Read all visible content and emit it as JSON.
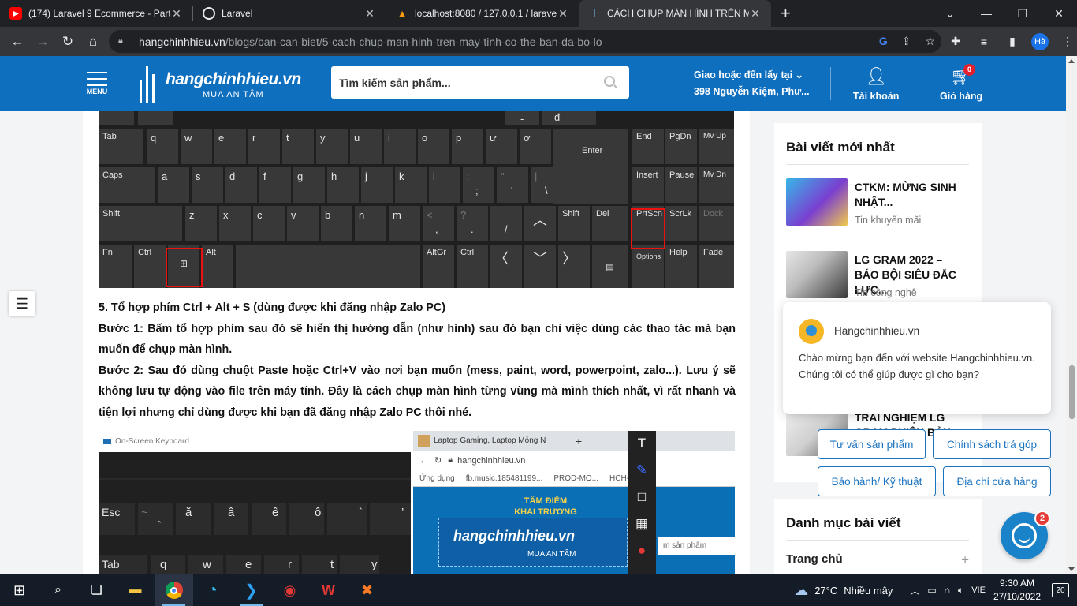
{
  "browser": {
    "tabs": [
      {
        "title": "(174) Laravel 9 Ecommerce - Part",
        "icon": "youtube-icon",
        "color": "#ff0000"
      },
      {
        "title": "Laravel",
        "icon": "globe-icon",
        "color": "#e8eaed"
      },
      {
        "title": "localhost:8080 / 127.0.0.1 / larave",
        "icon": "phpmyadmin-icon",
        "color": "#f89c0e"
      },
      {
        "title": "CÁCH CHỤP MÀN HÌNH TRÊN M",
        "icon": "hangchinhhieu-icon",
        "color": "#0f6fbf"
      }
    ],
    "new_tab": "+",
    "url_domain": "hangchinhhieu.vn",
    "url_path": "/blogs/ban-can-biet/5-cach-chup-man-hinh-tren-may-tinh-co-the-ban-da-bo-lo",
    "profile_initials": "Hà"
  },
  "header": {
    "menu_label": "MENU",
    "brand": "hangchinhhieu.vn",
    "slogan": "MUA AN TÂM",
    "search_placeholder": "Tìm kiếm sản phẩm...",
    "delivery_line1": "Giao hoặc đến lấy tại",
    "delivery_line2": "398 Nguyễn Kiệm, Phư...",
    "account_label": "Tài khoản",
    "cart_label": "Giỏ hàng",
    "cart_count": "0",
    "brand_color": "#0f6fbf"
  },
  "article": {
    "heading5": "5. Tổ hợp phím Ctrl + Alt + S (dùng được khi đăng nhập Zalo PC)",
    "step1": "Bước 1: Bấm tổ hợp phím sau đó sẽ hiển thị hướng dẫn (như hình) sau đó bạn chỉ việc dùng các thao tác mà bạn muốn để chụp màn hình.",
    "step2": "Bước 2: Sau đó dùng chuột Paste hoặc Ctrl+V vào nơi bạn muốn (mess, paint, word, powerpoint, zalo...). Lưu ý sẽ không lưu tự động vào file trên máy tính. Đây là cách chụp màn hình từng vùng mà mình thích nhất, vì rất nhanh và tiện lợi nhưng chỉ dùng được khi bạn đã đăng nhập Zalo PC thôi nhé.",
    "keyboard_keys": {
      "tab": "Tab",
      "caps": "Caps",
      "shift": "Shift",
      "fn": "Fn",
      "ctrl": "Ctrl",
      "alt": "Alt",
      "q": "q",
      "w": "w",
      "e": "e",
      "r": "r",
      "t": "t",
      "y": "y",
      "u": "u",
      "i": "i",
      "o": "o",
      "p": "p",
      "u_horn": "ư",
      "o_horn": "ơ",
      "a": "a",
      "s": "s",
      "d": "d",
      "f": "f",
      "g": "g",
      "h": "h",
      "j": "j",
      "k": "k",
      "l": "l",
      "z": "z",
      "x": "x",
      "c": "c",
      "v": "v",
      "b": "b",
      "n": "n",
      "m": "m",
      "enter": "Enter",
      "end": "End",
      "pgdn": "PgDn",
      "mvup": "Mv Up",
      "insert": "Insert",
      "pause": "Pause",
      "mvdn": "Mv Dn",
      "shift_r": "Shift",
      "del": "Del",
      "prtscn": "PrtScn",
      "scrlk": "ScrLk",
      "dock": "Dock",
      "altgr": "AltGr",
      "ctrl_r": "Ctrl",
      "options": "Options",
      "help": "Help",
      "fade": "Fade",
      "minus": "-",
      "dstroke": "đ",
      "semicolon": ";",
      "quote": "'",
      "backslash": "\\",
      "lt": "<",
      "comma": ",",
      "qmark": "?",
      "period": ".",
      "slash": "/",
      "colon": ":",
      "dquote": "\"",
      "pipe": "|",
      "tilde": "~",
      "backtick": "`"
    },
    "osk_title": "On-Screen Keyboard",
    "osk_keys": {
      "esc": "Esc",
      "tilde": "~",
      "backtick": "`",
      "a_breve": "ă",
      "a_circ": "â",
      "e_circ": "ê",
      "o_circ": "ô",
      "grave": "`",
      "tab": "Tab",
      "q": "q",
      "w": "w",
      "e": "e",
      "r": "r",
      "t": "t",
      "y": "y"
    },
    "snip": {
      "tab_title": "Laptop Gaming, Laptop Mỏng N",
      "address": "hangchinhhieu.vn",
      "bookmarks": [
        "Ứng dụng",
        "fb.music.185481199...",
        "PROD-MO...",
        "HCH-MKT"
      ],
      "banner": "TÂM ĐIỂM KHAI TRƯƠNG",
      "brand": "hangchinhhieu.vn",
      "slogan": "MUA AN TÂM",
      "search_hint": "m sản phẩm",
      "tools": [
        "T",
        "✎",
        "□",
        "▦",
        "●"
      ]
    }
  },
  "sidebar": {
    "latest_title": "Bài viết mới nhất",
    "posts": [
      {
        "title": "CTKM: MỪNG SINH NHẬT...",
        "category": "Tin khuyến mãi"
      },
      {
        "title": "LG GRAM 2022 – BÁO BỘI SIÊU ĐẮC LỰC...",
        "category": "Tin công nghệ"
      },
      {
        "title": "TRẢI NGHIỆM LG GRAM PHIÊN BẢN 14...",
        "category": ""
      }
    ],
    "categories_title": "Danh mục bài viết",
    "categories": [
      {
        "label": "Trang chủ",
        "plus": "+"
      }
    ]
  },
  "chat": {
    "agent": "Hangchinhhieu.vn",
    "message": "Chào mừng bạn đến với website Hangchinhhieu.vn. Chúng tôi có thể giúp được gì cho bạn?",
    "quick_replies": [
      "Tư vấn sản phẩm",
      "Chính sách trả góp",
      "Bảo hành/ Kỹ thuật",
      "Địa chỉ cửa hàng"
    ],
    "unread": "2"
  },
  "taskbar": {
    "weather_temp": "27°C",
    "weather_text": "Nhiều mây",
    "language": "VIE",
    "time": "9:30 AM",
    "date": "27/10/2022",
    "notifications": "20"
  }
}
